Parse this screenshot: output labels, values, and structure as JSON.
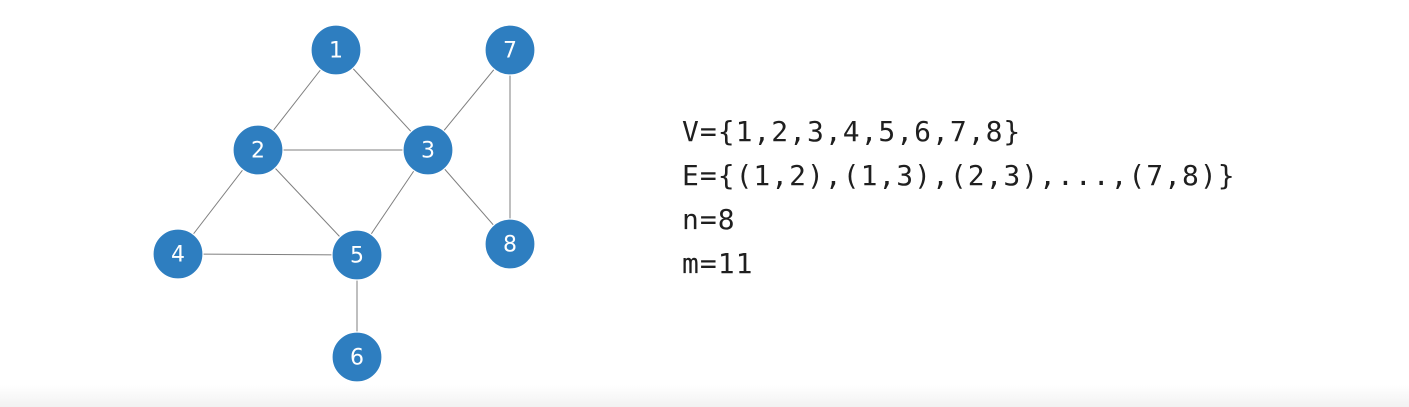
{
  "colors": {
    "node_fill": "#2e7ec0",
    "edge": "#7f7f7f"
  },
  "graph": {
    "nodes": [
      {
        "id": "1",
        "label": "1"
      },
      {
        "id": "2",
        "label": "2"
      },
      {
        "id": "3",
        "label": "3"
      },
      {
        "id": "4",
        "label": "4"
      },
      {
        "id": "5",
        "label": "5"
      },
      {
        "id": "6",
        "label": "6"
      },
      {
        "id": "7",
        "label": "7"
      },
      {
        "id": "8",
        "label": "8"
      }
    ],
    "edges": [
      [
        "1",
        "2"
      ],
      [
        "1",
        "3"
      ],
      [
        "2",
        "3"
      ],
      [
        "2",
        "4"
      ],
      [
        "2",
        "5"
      ],
      [
        "3",
        "5"
      ],
      [
        "3",
        "7"
      ],
      [
        "3",
        "8"
      ],
      [
        "4",
        "5"
      ],
      [
        "5",
        "6"
      ],
      [
        "7",
        "8"
      ]
    ]
  },
  "info": {
    "vertices": "V={1,2,3,4,5,6,7,8}",
    "edges": "E={(1,2),(1,3),(2,3),...,(7,8)}",
    "n": "n=8",
    "m": "m=11"
  }
}
